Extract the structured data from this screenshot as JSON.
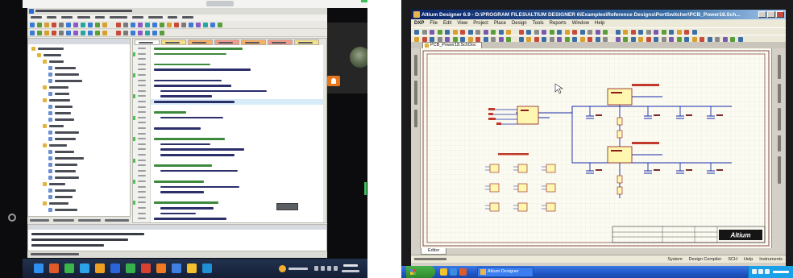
{
  "left_screen": {
    "taskbar": {
      "icons": [
        {
          "name": "windows-start-icon",
          "color": "#2f8ff0"
        },
        {
          "name": "taskbar-app-icon",
          "color": "#e05a2a"
        },
        {
          "name": "taskbar-app-icon",
          "color": "#3cb64b"
        },
        {
          "name": "taskbar-app-icon",
          "color": "#2aa3e8"
        },
        {
          "name": "taskbar-app-icon",
          "color": "#f0a020"
        },
        {
          "name": "taskbar-app-icon",
          "color": "#2b63d9"
        },
        {
          "name": "taskbar-app-icon",
          "color": "#35b04a"
        },
        {
          "name": "taskbar-app-icon",
          "color": "#d8412f"
        },
        {
          "name": "taskbar-app-icon",
          "color": "#f07a22"
        },
        {
          "name": "taskbar-app-icon",
          "color": "#3f7fe0"
        },
        {
          "name": "taskbar-app-icon",
          "color": "#f3c12c"
        },
        {
          "name": "taskbar-app-icon",
          "color": "#1f8fd6"
        }
      ]
    },
    "video_call": {
      "badge_icon": "microphone-icon"
    }
  },
  "right_screen": {
    "title": "Altium Designer 6.9 - D:\\PROGRAM FILES\\ALTIUM DESIGNER 6\\Examples\\Reference Designs\\PortSwitcher\\PCB_Power18.Sch...",
    "menu": [
      "DXP",
      "File",
      "Edit",
      "View",
      "Project",
      "Place",
      "Design",
      "Tools",
      "Reports",
      "Window",
      "Help"
    ],
    "document_tab": "PCB_Power18.SchDoc",
    "editor_tab": "Editor",
    "title_block_logo": "Altium",
    "status_panels": [
      "System",
      "Design Compiler",
      "SCH",
      "Help",
      "Instruments"
    ],
    "taskbar": {
      "app": "Altium Designer"
    }
  },
  "colors": {
    "altium_title_bar": "#0a246a",
    "xp_taskbar": "#1f56c8",
    "xp_start_button": "#2d8a2d",
    "schematic_wire": "#1a2aa8",
    "component_fill": "#fff6b0",
    "component_border": "#8b1a1a",
    "sheet_background": "#fbfbf2",
    "video_badge": "#e8761c"
  }
}
